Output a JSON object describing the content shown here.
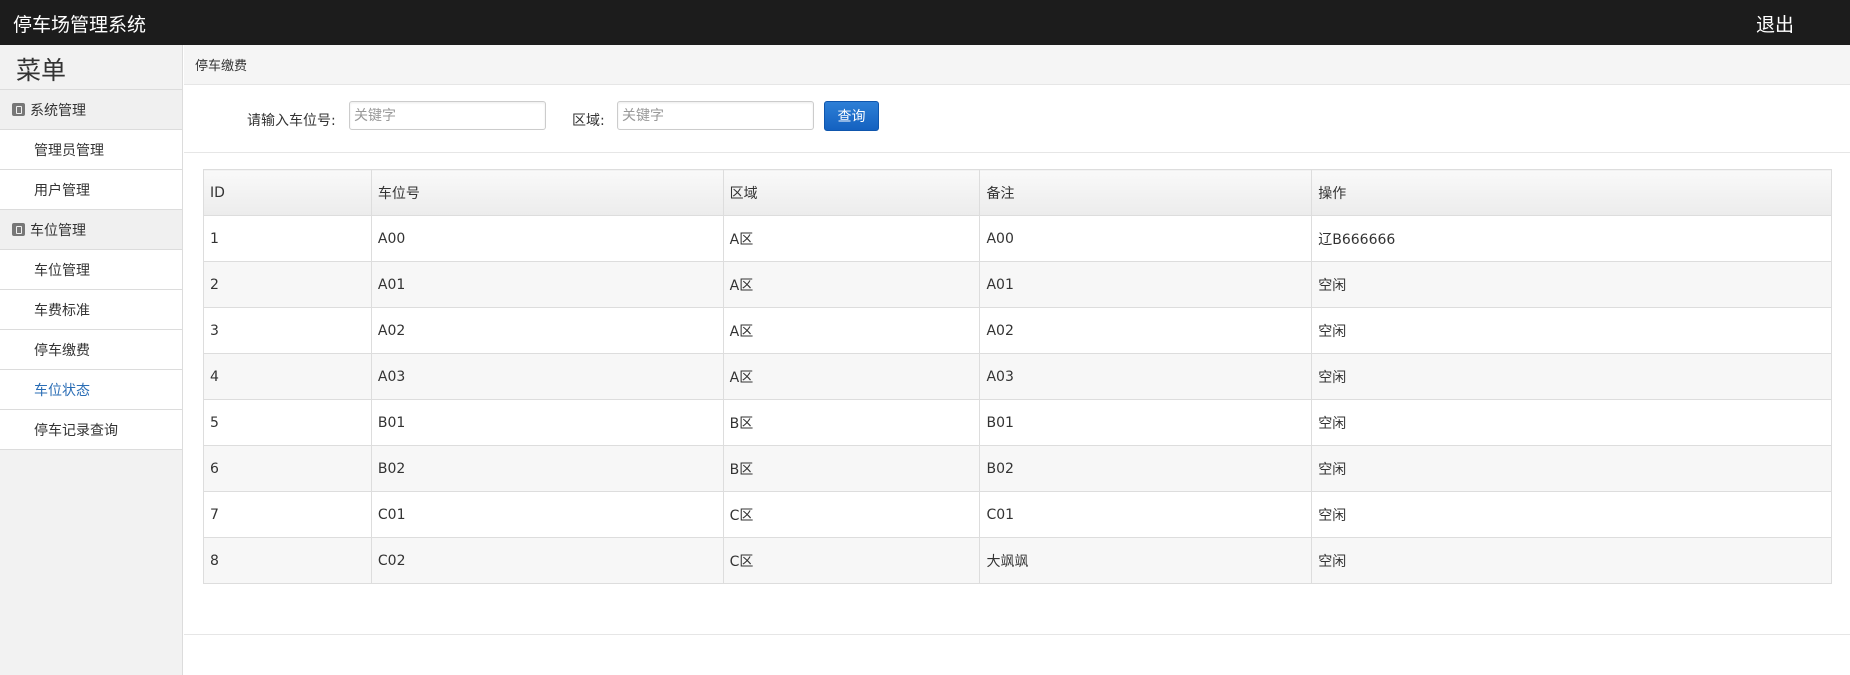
{
  "header": {
    "title": "停车场管理系统",
    "logout_label": "退出"
  },
  "sidebar": {
    "menu_title": "菜单",
    "groups": [
      {
        "label": "系统管理",
        "items": [
          {
            "label": "管理员管理"
          },
          {
            "label": "用户管理"
          }
        ]
      },
      {
        "label": "车位管理",
        "items": [
          {
            "label": "车位管理"
          },
          {
            "label": "车费标准"
          },
          {
            "label": "停车缴费"
          },
          {
            "label": "车位状态",
            "active": true
          },
          {
            "label": "停车记录查询"
          }
        ]
      }
    ]
  },
  "breadcrumb": "停车缴费",
  "search": {
    "space_label": "请输入车位号:",
    "space_placeholder": "关键字",
    "area_label": "区域:",
    "area_placeholder": "关键字",
    "query_button": "查询"
  },
  "table": {
    "columns": [
      "ID",
      "车位号",
      "区域",
      "备注",
      "操作"
    ],
    "rows": [
      [
        "1",
        "A00",
        "A区",
        "A00",
        "辽B666666"
      ],
      [
        "2",
        "A01",
        "A区",
        "A01",
        "空闲"
      ],
      [
        "3",
        "A02",
        "A区",
        "A02",
        "空闲"
      ],
      [
        "4",
        "A03",
        "A区",
        "A03",
        "空闲"
      ],
      [
        "5",
        "B01",
        "B区",
        "B01",
        "空闲"
      ],
      [
        "6",
        "B02",
        "B区",
        "B02",
        "空闲"
      ],
      [
        "7",
        "C01",
        "C区",
        "C01",
        "空闲"
      ],
      [
        "8",
        "C02",
        "C区",
        "大飒飒",
        "空闲"
      ]
    ]
  },
  "colors": {
    "topbar_bg": "#1c1c1c",
    "accent_button": "#1461c0",
    "active_link": "#2a6db5"
  }
}
